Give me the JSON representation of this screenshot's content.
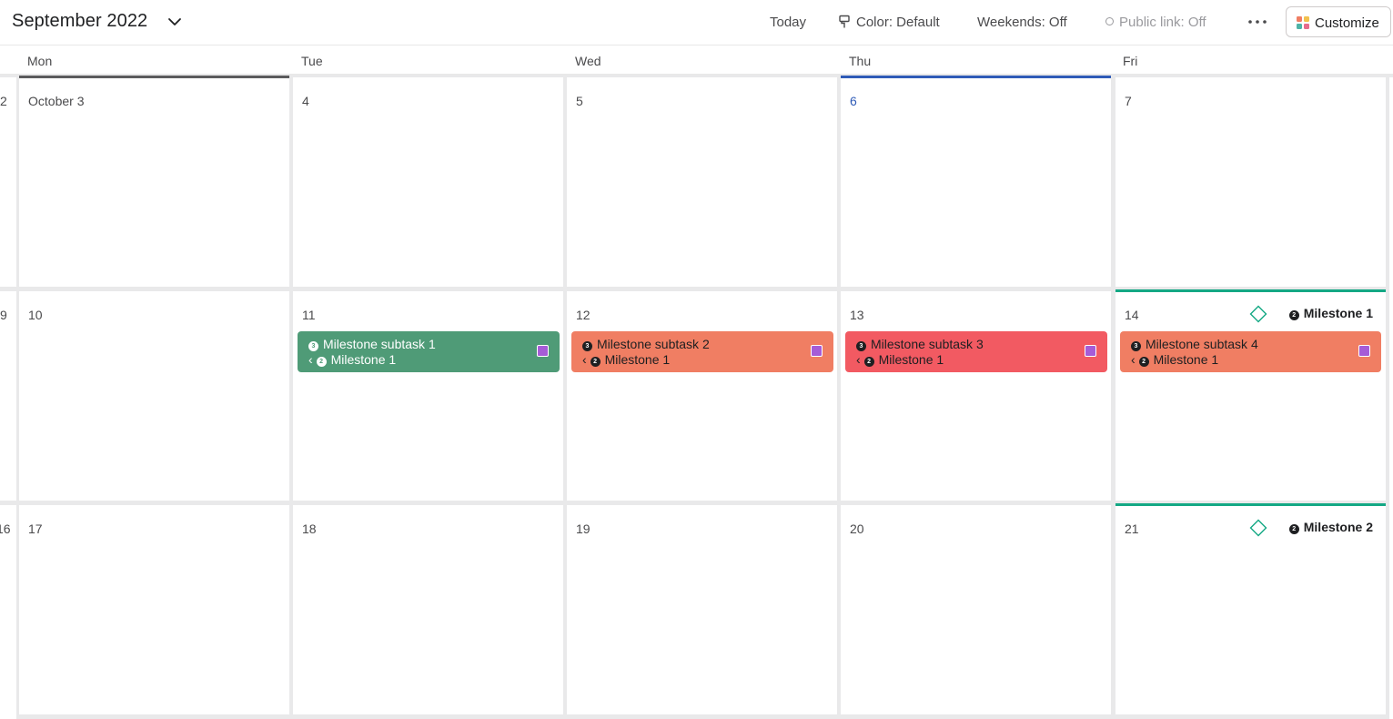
{
  "header": {
    "month_title": "September 2022",
    "today_label": "Today",
    "color_label": "Color: Default",
    "weekends_label": "Weekends: Off",
    "public_link_label": "Public link: Off",
    "customize_label": "Customize"
  },
  "days": [
    "Mon",
    "Tue",
    "Wed",
    "Thu",
    "Fri"
  ],
  "left_edge_numbers": [
    "2",
    "9",
    "16"
  ],
  "weeks": [
    [
      "October 3",
      "4",
      "5",
      "6",
      "7"
    ],
    [
      "10",
      "11",
      "12",
      "13",
      "14"
    ],
    [
      "17",
      "18",
      "19",
      "20",
      "21"
    ]
  ],
  "tasks": [
    {
      "title": "Milestone subtask 1",
      "parent": "Milestone 1",
      "badge": "3",
      "parent_badge": "2",
      "color": "#4f9b77"
    },
    {
      "title": "Milestone subtask 2",
      "parent": "Milestone 1",
      "badge": "3",
      "parent_badge": "2",
      "color": "#f07e63"
    },
    {
      "title": "Milestone subtask 3",
      "parent": "Milestone 1",
      "badge": "3",
      "parent_badge": "2",
      "color": "#f25a62"
    },
    {
      "title": "Milestone subtask 4",
      "parent": "Milestone 1",
      "badge": "3",
      "parent_badge": "2",
      "color": "#f07e63"
    }
  ],
  "milestones": [
    {
      "title": "Milestone 1",
      "badge": "2"
    },
    {
      "title": "Milestone 2",
      "badge": "2"
    }
  ],
  "colors": {
    "today_accent": "#2f5bb7",
    "milestone_accent": "#14a884",
    "week_accent": "#5b5b5d",
    "subtask_marker": "#a65cd7"
  }
}
